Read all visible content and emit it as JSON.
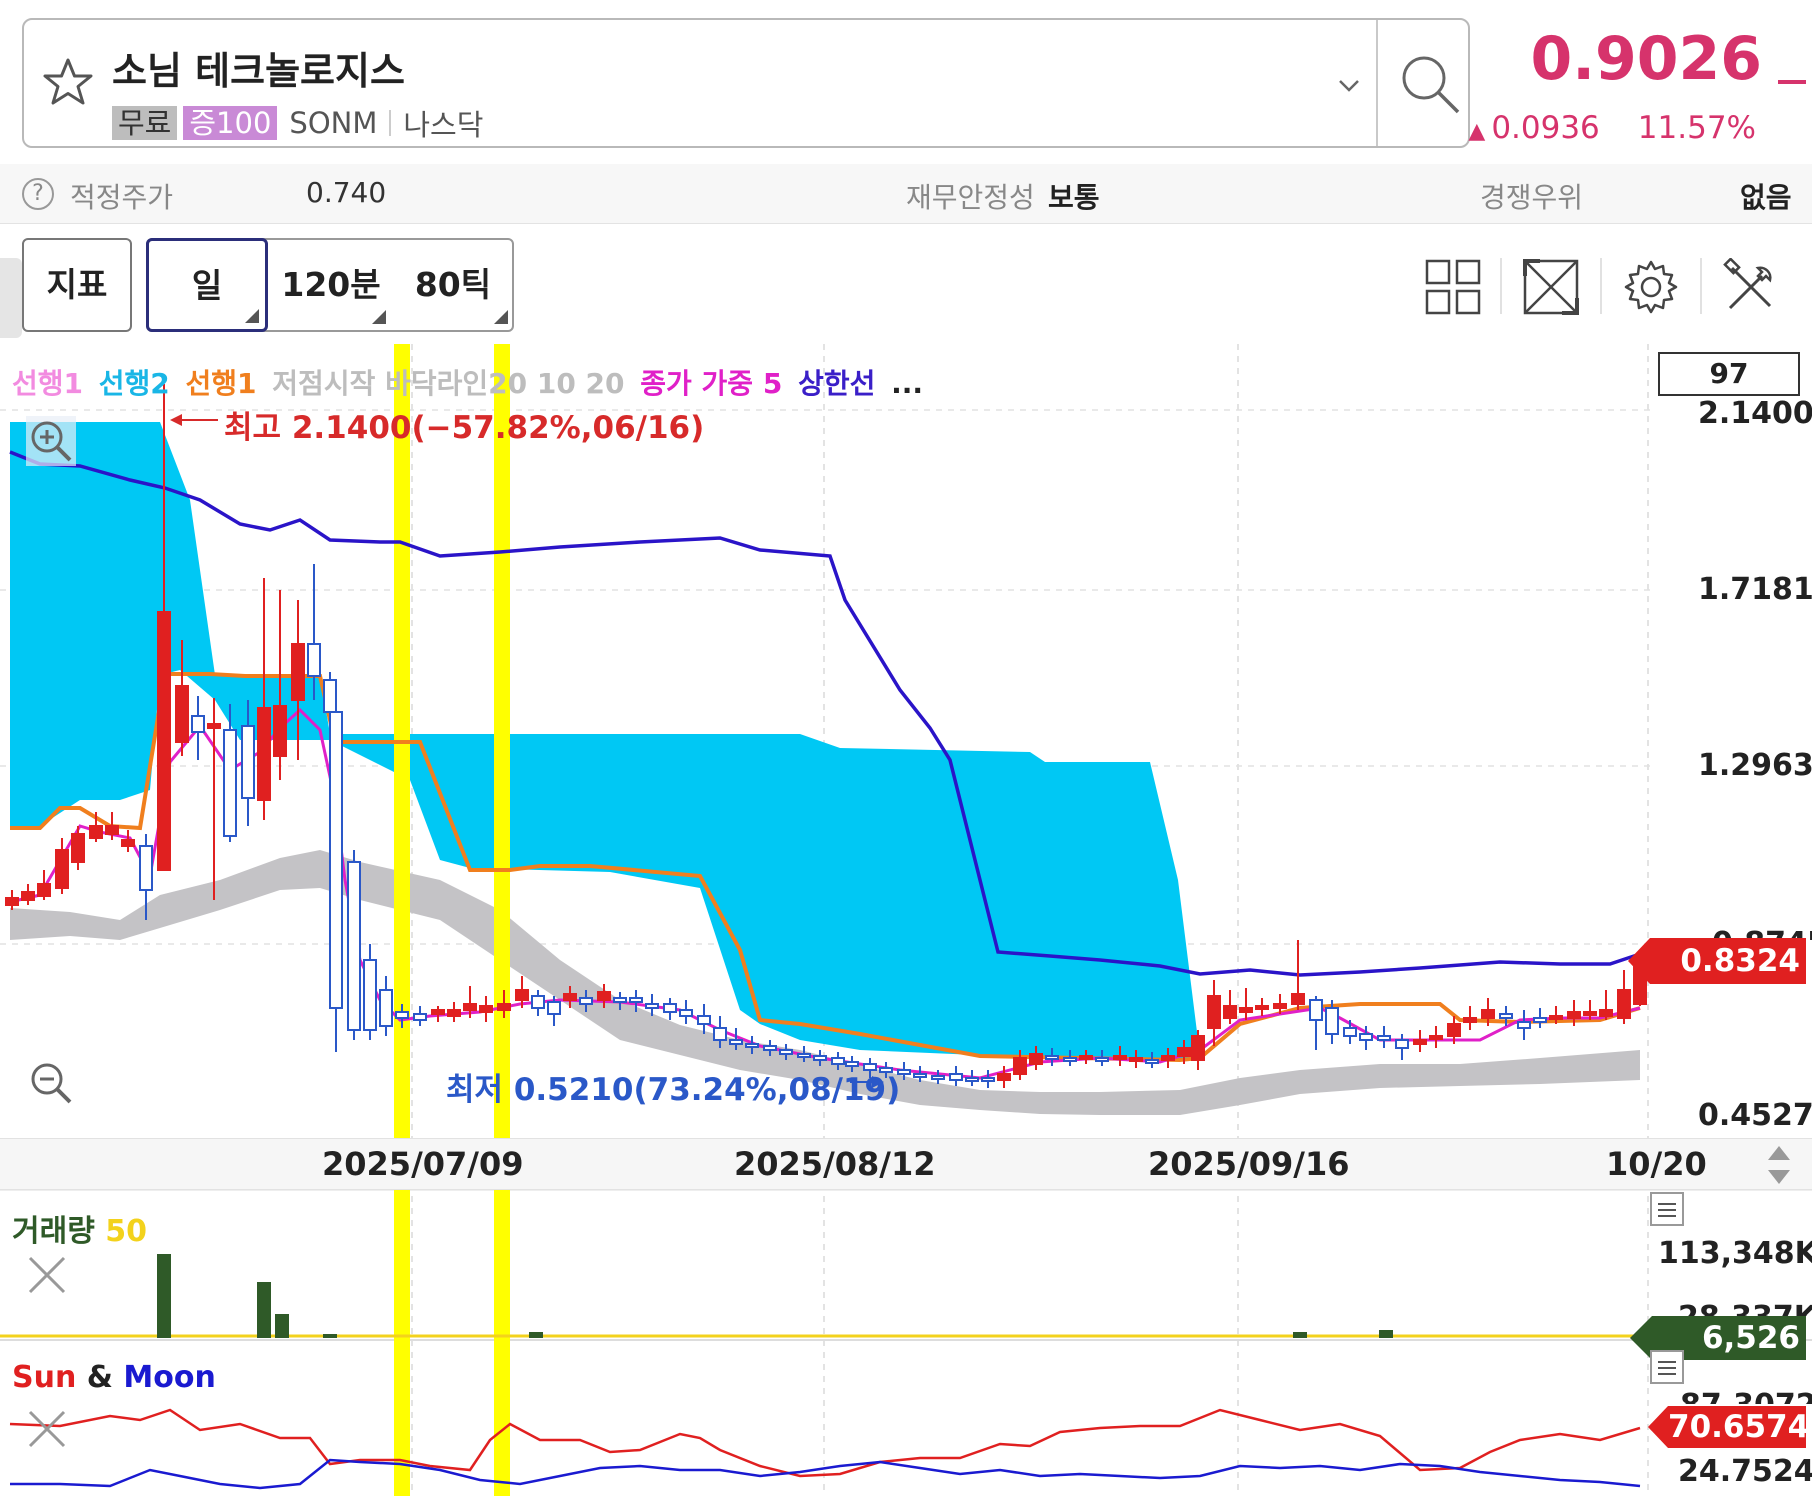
{
  "header": {
    "stock_name": "소님 테크놀로지스",
    "tag_free": "무료",
    "tag_margin": "증100",
    "ticker": "SONM",
    "exchange": "나스닥",
    "price": "0.9026",
    "change": "0.0936",
    "change_pct": "11.57%",
    "up_color": "#d6336c"
  },
  "info_bar": {
    "fair_price_label": "적정주가",
    "fair_price_value": "0.740",
    "stability_label": "재무안정성",
    "stability_value": "보통",
    "competitive_label": "경쟁우위",
    "competitive_value": "없음"
  },
  "toolbar": {
    "indicator_label": "지표",
    "period_day": "일",
    "period_120m": "120분",
    "period_80t": "80틱",
    "icons": [
      "layout-grid-icon",
      "fullscreen-icon",
      "settings-icon",
      "tools-icon"
    ]
  },
  "chart_legend": {
    "items": [
      {
        "text": "선행1",
        "color": "#f28be0"
      },
      {
        "text": "선행2",
        "color": "#19b6e6"
      },
      {
        "text": "선행1",
        "color": "#f07f1e"
      },
      {
        "text": "저점시작 바닥라인20 10 20",
        "color": "#bdbdbd"
      },
      {
        "text": "종가 가중 5",
        "color": "#e020c8"
      },
      {
        "text": "상한선",
        "color": "#3a1fc8"
      },
      {
        "text": "...",
        "color": "#222222"
      }
    ],
    "count": "97"
  },
  "chart_data": {
    "type": "candlestick",
    "y_axis_labels": [
      "2.1400",
      "1.7181",
      "1.2963",
      "0.8745",
      "0.4527"
    ],
    "ylim": [
      0.4527,
      2.14
    ],
    "current_price_tag": "0.8324",
    "x_axis_labels": [
      "2025/07/09",
      "2025/08/12",
      "2025/09/16",
      "10/20"
    ],
    "annotation_high": "최고 2.1400(−57.82%,06/16)",
    "annotation_low": "최저 0.5210(73.24%,08/19)",
    "highlight_color": "#ffff00",
    "cloud_color": "#00c8f4",
    "band_color": "#c4c3c6"
  },
  "volume_panel": {
    "title": "거래량",
    "period": "50",
    "max_label": "113,348K",
    "mid_label": "28,337K",
    "current_tag": "6,526"
  },
  "sun_moon_panel": {
    "title_sun": "Sun",
    "title_amp": "&",
    "title_moon": "Moon",
    "top_label": "87.3072",
    "current_tag": "70.6574",
    "bottom_label": "24.7524"
  }
}
